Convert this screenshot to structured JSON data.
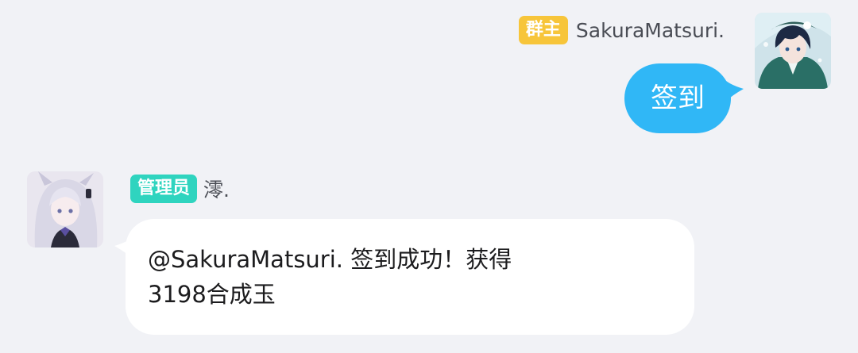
{
  "messages": [
    {
      "direction": "outgoing",
      "role_badge": "群主",
      "role_badge_color": "#f7c53a",
      "sender": "SakuraMatsuri.",
      "text": "签到",
      "bubble_color": "#30b7f6"
    },
    {
      "direction": "incoming",
      "role_badge": "管理员",
      "role_badge_color": "#2fd4bf",
      "sender": "澪.",
      "lines": [
        "@SakuraMatsuri. 签到成功！获得",
        "3198合成玉"
      ],
      "bubble_color": "#ffffff"
    }
  ],
  "colors": {
    "background": "#f1f2f6",
    "name_text": "#4a4d55"
  },
  "icons": [
    "anime-boy-avatar",
    "anime-girl-avatar"
  ]
}
